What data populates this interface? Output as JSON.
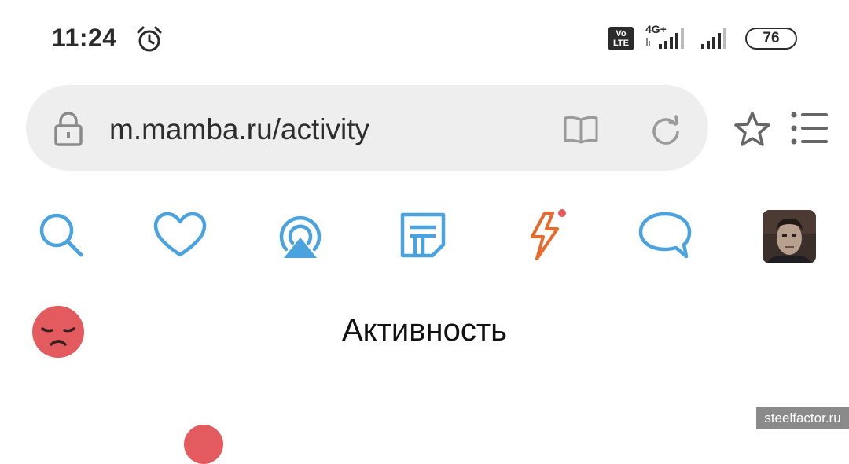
{
  "status_bar": {
    "time": "11:24",
    "volte": "Vo LTE",
    "network": "4G+",
    "battery": "76"
  },
  "browser": {
    "url": "m.mamba.ru/activity"
  },
  "nav": {
    "items": [
      "search-icon",
      "heart-icon",
      "radar-icon",
      "notes-icon",
      "lightning-icon",
      "chat-icon"
    ],
    "accent_color": "#4aa3df",
    "lightning_color": "#e8692a",
    "has_notification_dot": true
  },
  "page": {
    "title": "Активность",
    "mood_color": "#e35b5e"
  },
  "watermark": "steelfactor.ru"
}
